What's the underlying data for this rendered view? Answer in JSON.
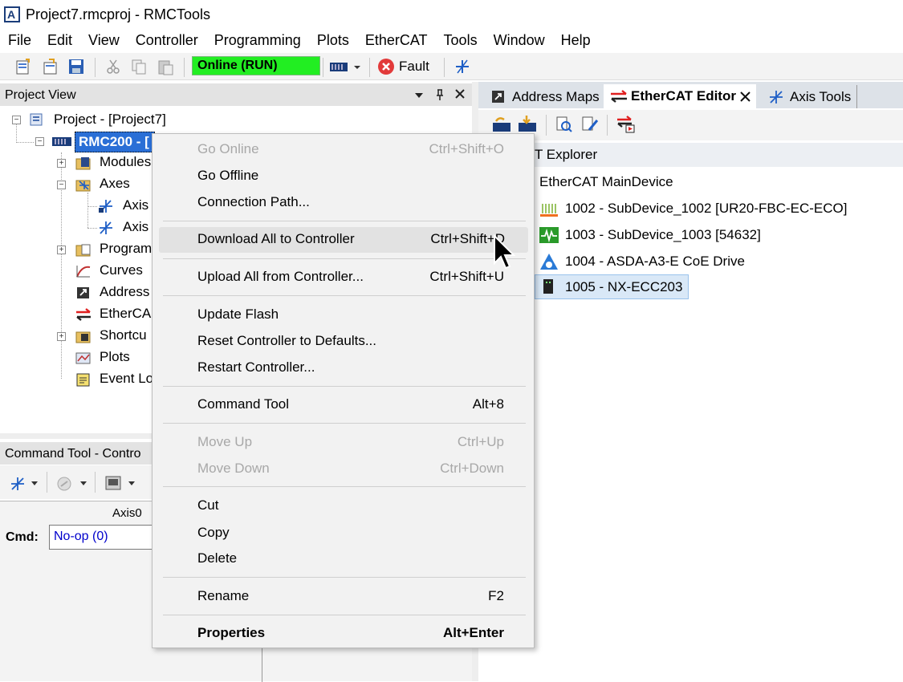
{
  "window": {
    "title": "Project7.rmcproj - RMCTools"
  },
  "menubar": [
    "File",
    "Edit",
    "View",
    "Controller",
    "Programming",
    "Plots",
    "EtherCAT",
    "Tools",
    "Window",
    "Help"
  ],
  "toolbar": {
    "status": "Online (RUN)",
    "fault_label": "Fault",
    "status_color": "#22ee22"
  },
  "project_view": {
    "title": "Project View",
    "root": "Project - [Project7]",
    "controller": "RMC200 - [",
    "children": [
      "Modules",
      "Axes",
      "Axis",
      "Axis",
      "Program",
      "Curves",
      "Address",
      "EtherCA",
      "Shortcu",
      "Plots",
      "Event Lo"
    ]
  },
  "tabs": [
    {
      "label": "Address Maps"
    },
    {
      "label": "EtherCAT Editor",
      "active": true
    },
    {
      "label": "Axis Tools"
    }
  ],
  "explorer": {
    "header": "T Explorer",
    "main_device": "EtherCAT MainDevice",
    "devices": [
      "1002 - SubDevice_1002 [UR20-FBC-EC-ECO]",
      "1003 - SubDevice_1003 [54632]",
      "1004 - ASDA-A3-E CoE Drive",
      "1005 - NX-ECC203"
    ]
  },
  "command_tool": {
    "title": "Command Tool - Contro",
    "column": "Axis0",
    "cmd_label": "Cmd:",
    "cmd_value": "No-op (0)"
  },
  "context_menu": {
    "go_online": {
      "label": "Go Online",
      "shortcut": "Ctrl+Shift+O"
    },
    "go_offline": {
      "label": "Go Offline"
    },
    "connection_path": {
      "label": "Connection Path..."
    },
    "download_all": {
      "label": "Download All to Controller",
      "shortcut": "Ctrl+Shift+D"
    },
    "upload_all": {
      "label": "Upload All from Controller...",
      "shortcut": "Ctrl+Shift+U"
    },
    "update_flash": {
      "label": "Update Flash"
    },
    "reset_defaults": {
      "label": "Reset Controller to Defaults..."
    },
    "restart": {
      "label": "Restart Controller..."
    },
    "command_tool": {
      "label": "Command Tool",
      "shortcut": "Alt+8"
    },
    "move_up": {
      "label": "Move Up",
      "shortcut": "Ctrl+Up"
    },
    "move_down": {
      "label": "Move Down",
      "shortcut": "Ctrl+Down"
    },
    "cut": {
      "label": "Cut"
    },
    "copy": {
      "label": "Copy"
    },
    "delete": {
      "label": "Delete"
    },
    "rename": {
      "label": "Rename",
      "shortcut": "F2"
    },
    "properties": {
      "label": "Properties",
      "shortcut": "Alt+Enter"
    }
  }
}
